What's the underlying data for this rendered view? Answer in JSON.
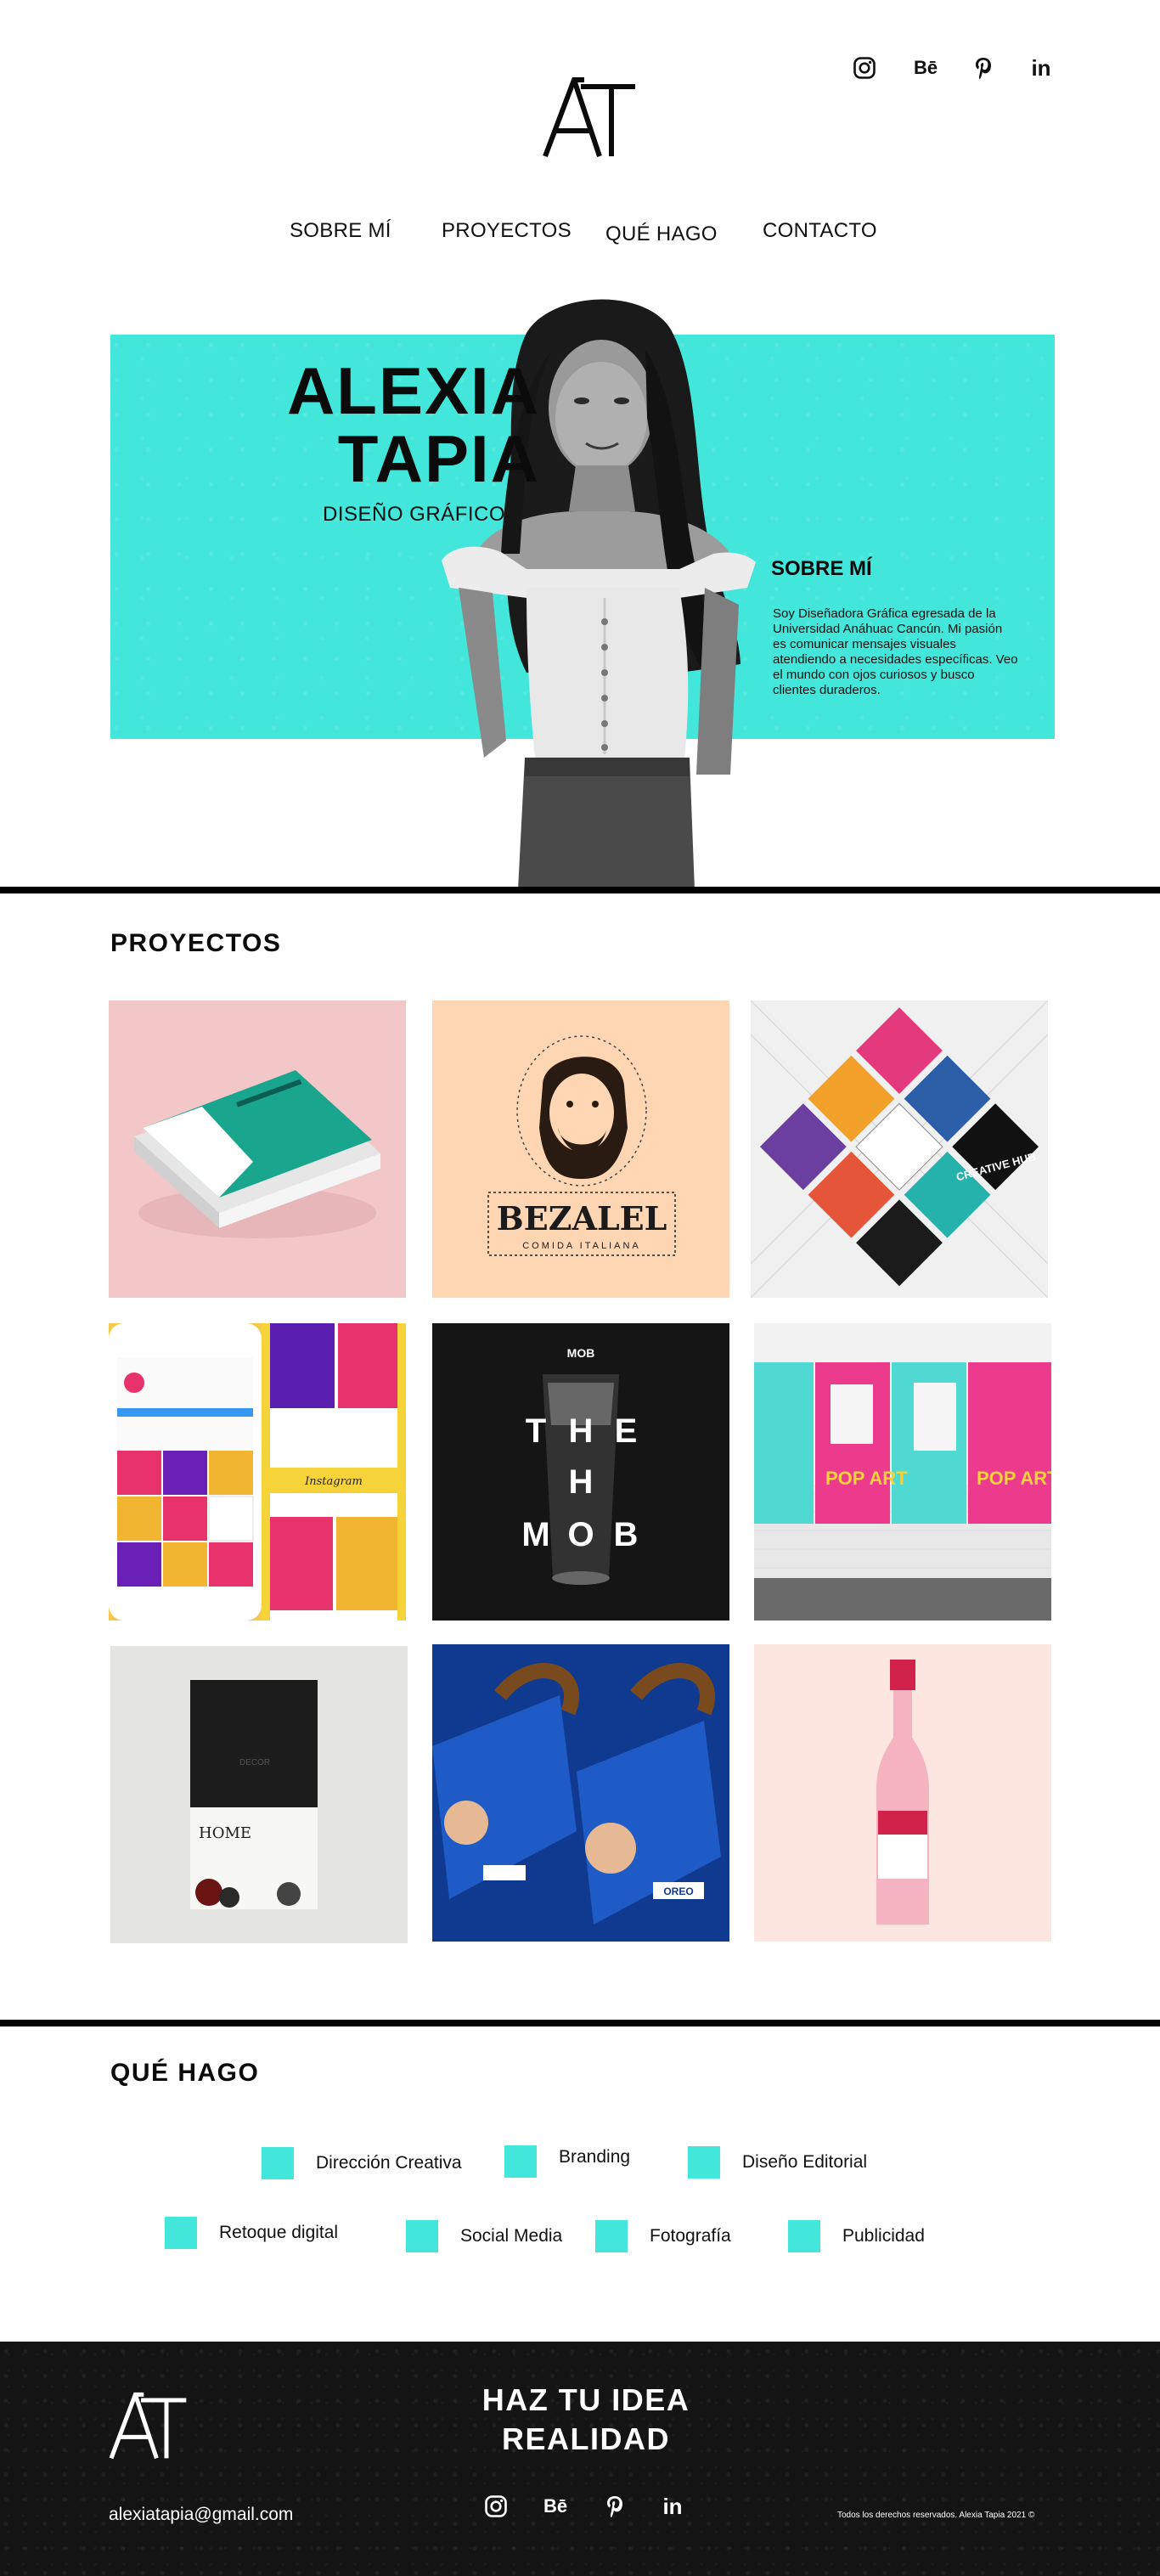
{
  "header": {
    "social": [
      {
        "name": "instagram",
        "icon": "instagram-icon"
      },
      {
        "name": "behance",
        "icon": "behance-icon",
        "glyph": "Bē"
      },
      {
        "name": "pinterest",
        "icon": "pinterest-icon"
      },
      {
        "name": "linkedin",
        "icon": "linkedin-icon",
        "glyph": "in"
      }
    ],
    "nav": [
      "SOBRE MÍ",
      "PROYECTOS",
      "QUÉ HAGO",
      "CONTACTO"
    ]
  },
  "hero": {
    "name_line1": "ALEXIA",
    "name_line2": "TAPIA",
    "role": "DISEÑO GRÁFICO",
    "about_title": "SOBRE MÍ",
    "about_text": "Soy Diseñadora Gráfica egresada de la Universidad Anáhuac Cancún. Mi pasión es comunicar mensajes visuales atendiendo a necesidades específicas. Veo el mundo con ojos curiosos y busco clientes duraderos.",
    "accent": "#42e6da"
  },
  "projects": {
    "title": "PROYECTOS",
    "tiles": [
      {
        "label": "book-editorial"
      },
      {
        "label": "bezalel",
        "brand": "BEZALEL",
        "tagline": "COMIDA ITALIANA"
      },
      {
        "label": "creative-hub",
        "brand": "CREATIVE HUB"
      },
      {
        "label": "instagram-feed",
        "caption": "Instagram"
      },
      {
        "label": "the-mob",
        "letters": [
          "T",
          "H",
          "E",
          "H",
          "M",
          "O",
          "B"
        ],
        "badge": "MOB"
      },
      {
        "label": "pop-art",
        "text": "POP ART"
      },
      {
        "label": "home-box",
        "text": "HOME"
      },
      {
        "label": "oreo-posters",
        "brand": "OREO"
      },
      {
        "label": "wine-bottle"
      }
    ]
  },
  "services": {
    "title": "QUÉ HAGO",
    "items": [
      "Dirección Creativa",
      "Branding",
      "Diseño Editorial",
      "Retoque digital",
      "Social Media",
      "Fotografía",
      "Publicidad"
    ]
  },
  "footer": {
    "cta_line1": "HAZ TU IDEA",
    "cta_line2": "REALIDAD",
    "email": "alexiatapia@gmail.com",
    "copyright": "Todos los derechos reservados. Alexia Tapia 2021 ©"
  }
}
